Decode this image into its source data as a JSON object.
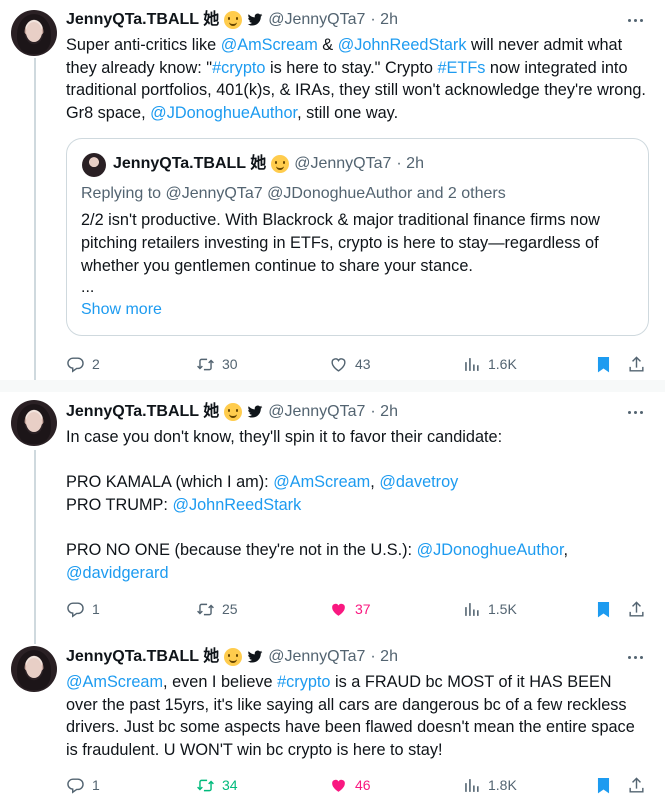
{
  "colors": {
    "accent": "#1d9bf0",
    "retweet_active": "#00ba7c",
    "like_active": "#f91880",
    "muted": "#536471"
  },
  "icons": {
    "verified": "blue-bird-icon",
    "emoji": "smiling-face-emoji",
    "more": "ellipsis-icon",
    "reply": "reply-bubble-icon",
    "retweet": "retweet-icon",
    "like": "heart-icon",
    "views": "analytics-icon",
    "bookmark": "bookmark-icon",
    "share": "share-icon"
  },
  "tweets": [
    {
      "author": {
        "name": "JennyQTa.TBALL 她",
        "handle": "@JennyQTa7",
        "time": "· 2h"
      },
      "body": [
        {
          "t": "Super anti-critics like ",
          "link": false
        },
        {
          "t": "@AmScream",
          "link": true
        },
        {
          "t": " & ",
          "link": false
        },
        {
          "t": "@JohnReedStark",
          "link": true
        },
        {
          "t": " will never admit what they already know: \"",
          "link": false
        },
        {
          "t": "#crypto",
          "link": true
        },
        {
          "t": " is here to stay.\" Crypto ",
          "link": false
        },
        {
          "t": "#ETFs",
          "link": true
        },
        {
          "t": " now integrated into traditional portfolios, 401(k)s, & IRAs, they still won't acknowledge they're wrong. Gr8 space, ",
          "link": false
        },
        {
          "t": "@JDonoghueAuthor",
          "link": true
        },
        {
          "t": ", still one way.",
          "link": false
        }
      ],
      "quote": {
        "author": {
          "name": "JennyQTa.TBALL 她",
          "handle": "@JennyQTa7",
          "time": "· 2h"
        },
        "replying_to": "Replying to @JennyQTa7 @JDonoghueAuthor and 2 others",
        "text": "2/2 isn't productive. With Blackrock & major traditional finance firms now pitching retailers investing in ETFs, crypto is here to stay—regardless of whether you gentlemen continue to share your stance.",
        "ellipsis": "...",
        "show_more": "Show more"
      },
      "stats": {
        "replies": "2",
        "retweets": "30",
        "likes": "43",
        "views": "1.6K",
        "retweeted": false,
        "liked": false
      }
    },
    {
      "author": {
        "name": "JennyQTa.TBALL 她",
        "handle": "@JennyQTa7",
        "time": "· 2h"
      },
      "lines": [
        [
          {
            "t": "In case you don't know, they'll spin it to favor their candidate:",
            "link": false
          }
        ],
        [],
        [
          {
            "t": "PRO KAMALA (which I am): ",
            "link": false
          },
          {
            "t": "@AmScream",
            "link": true
          },
          {
            "t": ", ",
            "link": false
          },
          {
            "t": "@davetroy",
            "link": true
          }
        ],
        [
          {
            "t": "PRO TRUMP: ",
            "link": false
          },
          {
            "t": "@JohnReedStark",
            "link": true
          }
        ],
        [],
        [
          {
            "t": "PRO NO ONE (because they're not in the U.S.): ",
            "link": false
          },
          {
            "t": "@JDonoghueAuthor",
            "link": true
          },
          {
            "t": ",",
            "link": false
          }
        ],
        [
          {
            "t": "@davidgerard",
            "link": true
          }
        ]
      ],
      "stats": {
        "replies": "1",
        "retweets": "25",
        "likes": "37",
        "views": "1.5K",
        "retweeted": false,
        "liked": true
      }
    },
    {
      "author": {
        "name": "JennyQTa.TBALL 她",
        "handle": "@JennyQTa7",
        "time": "· 2h"
      },
      "body": [
        {
          "t": "@AmScream",
          "link": true
        },
        {
          "t": ", even I believe ",
          "link": false
        },
        {
          "t": "#crypto",
          "link": true
        },
        {
          "t": " is a FRAUD bc MOST of it HAS BEEN over the past 15yrs, it's like saying all cars are dangerous bc of a few reckless drivers. Just bc some aspects have been flawed doesn't mean the entire space is fraudulent. U WON'T win bc crypto is here to stay!",
          "link": false
        }
      ],
      "stats": {
        "replies": "1",
        "retweets": "34",
        "likes": "46",
        "views": "1.8K",
        "retweeted": true,
        "liked": true
      }
    }
  ]
}
